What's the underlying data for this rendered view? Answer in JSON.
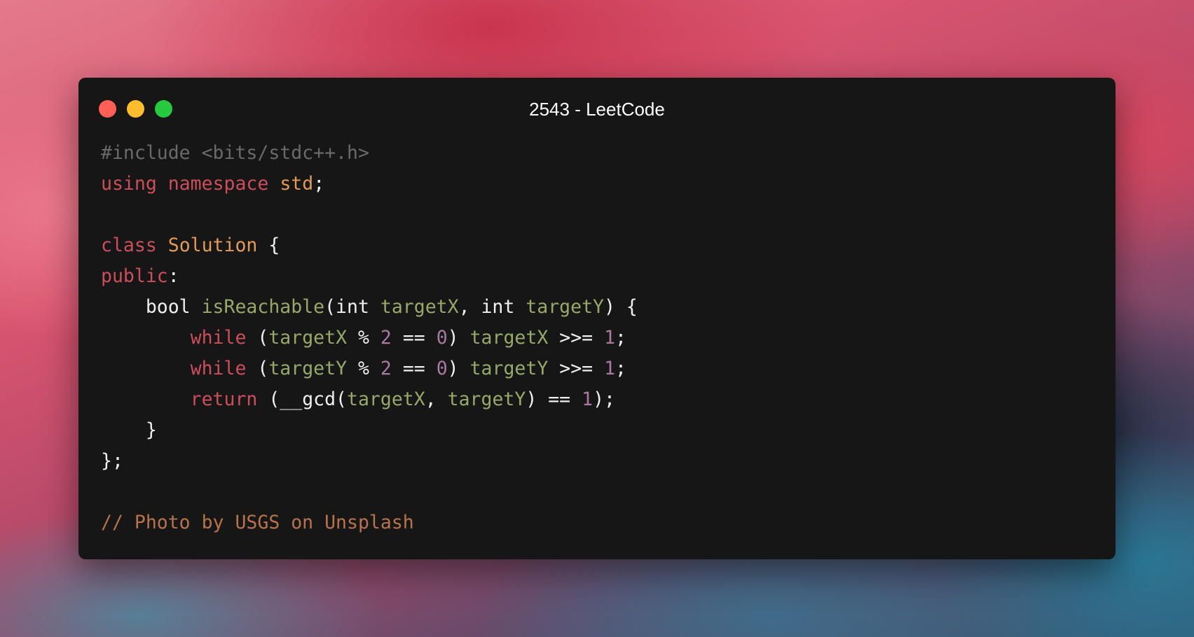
{
  "window": {
    "title": "2543 - LeetCode",
    "traffic_lights": {
      "close_color": "#ff5f56",
      "minimize_color": "#ffbd2e",
      "zoom_color": "#27c93f"
    }
  },
  "colors": {
    "editor_background": "#161616",
    "keyword": "#cc4e5c",
    "type": "#e39b57",
    "identifier": "#98a868",
    "number": "#a77ba0",
    "preprocessor": "#6a6a6a",
    "comment": "#b8734a"
  },
  "code": {
    "l1": {
      "a": "#include <bits/stdc++.h>"
    },
    "l2": {
      "a": "using",
      "b": " ",
      "c": "namespace",
      "d": " ",
      "e": "std",
      "f": ";"
    },
    "l3": {},
    "l4": {
      "a": "class",
      "b": " ",
      "c": "Solution",
      "d": " {"
    },
    "l5": {
      "a": "public",
      "b": ":"
    },
    "l6": {
      "a": "    bool ",
      "b": "isReachable",
      "c": "(int ",
      "d": "targetX",
      "e": ", int ",
      "f": "targetY",
      "g": ") {"
    },
    "l7": {
      "a": "        ",
      "b": "while",
      "c": " (",
      "d": "targetX",
      "e": " % ",
      "f": "2",
      "g": " == ",
      "h": "0",
      "i": ") ",
      "j": "targetX",
      "k": " >>= ",
      "l": "1",
      "m": ";"
    },
    "l8": {
      "a": "        ",
      "b": "while",
      "c": " (",
      "d": "targetY",
      "e": " % ",
      "f": "2",
      "g": " == ",
      "h": "0",
      "i": ") ",
      "j": "targetY",
      "k": " >>= ",
      "l": "1",
      "m": ";"
    },
    "l9": {
      "a": "        ",
      "b": "return",
      "c": " (__gcd(",
      "d": "targetX",
      "e": ", ",
      "f": "targetY",
      "g": ") == ",
      "h": "1",
      "i": ");"
    },
    "l10": {
      "a": "    }"
    },
    "l11": {
      "a": "};"
    },
    "l12": {},
    "l13": {
      "a": "// Photo by USGS on Unsplash"
    }
  }
}
